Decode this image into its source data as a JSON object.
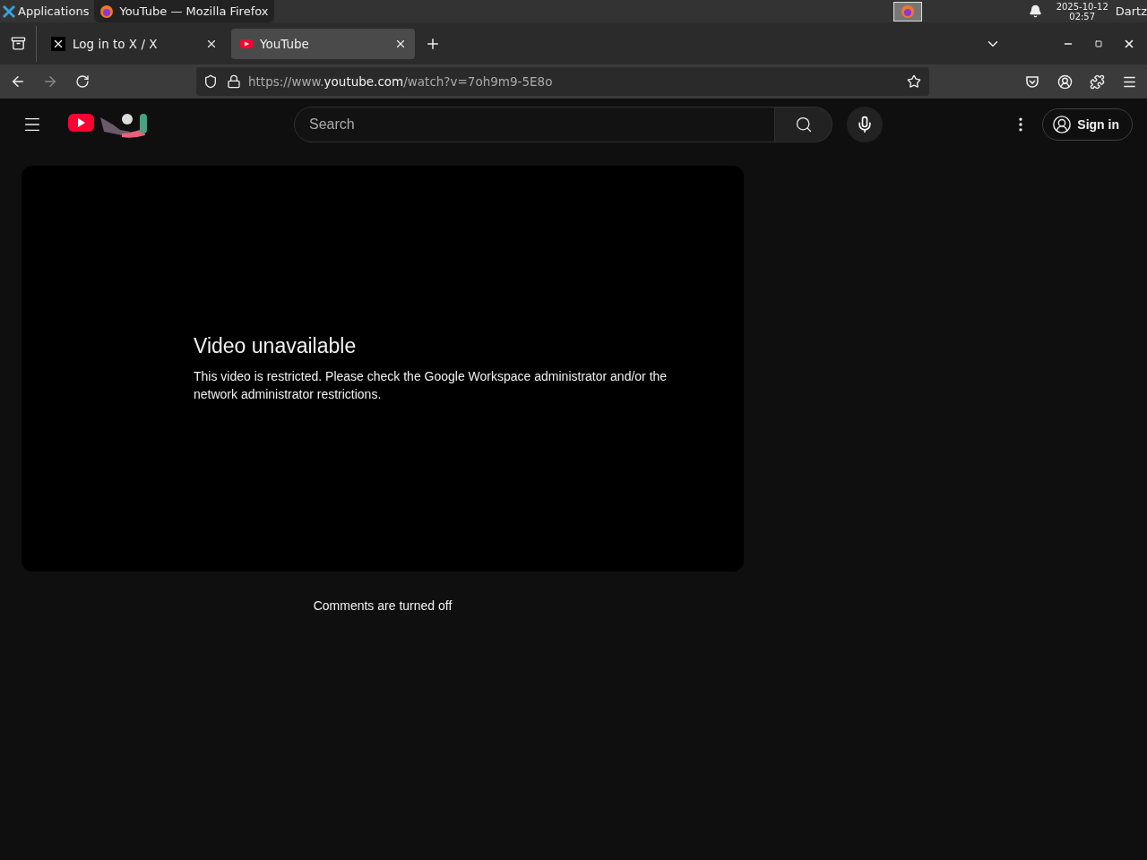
{
  "desktop_panel": {
    "apps_label": "Applications",
    "window_title": "YouTube — Mozilla Firefox",
    "date": "2025-10-12",
    "time": "02:57",
    "user": "Dartz"
  },
  "tabs": [
    {
      "title": "Log in to X / X",
      "kind": "x",
      "selected": false
    },
    {
      "title": "YouTube",
      "kind": "youtube",
      "selected": true
    }
  ],
  "address_bar": {
    "scheme": "https://www.",
    "domain": "youtube.com",
    "path": "/watch?v=7oh9m9-5E8o"
  },
  "youtube": {
    "search": {
      "placeholder": "Search"
    },
    "sign_in": "Sign in",
    "player": {
      "title": "Video unavailable",
      "message": "This video is restricted. Please check the Google Workspace administrator and/or the network administrator restrictions."
    },
    "comments_note": "Comments are turned off"
  }
}
